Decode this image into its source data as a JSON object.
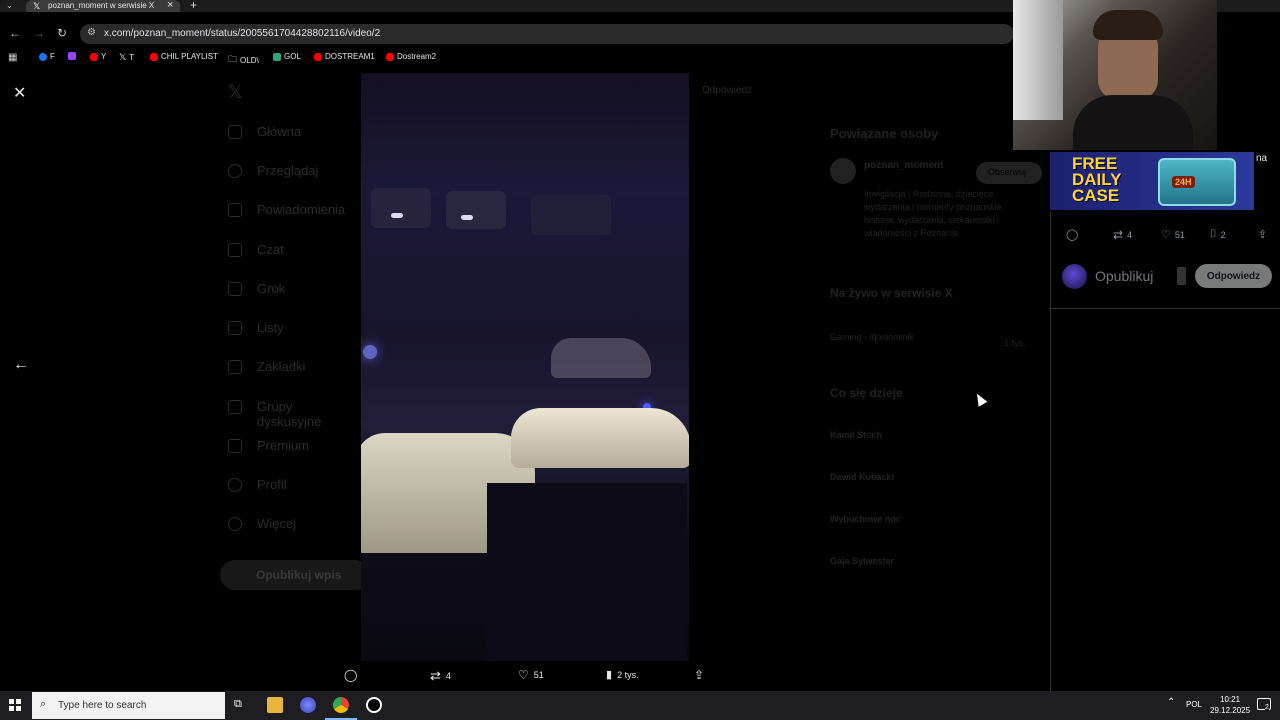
{
  "browser": {
    "tab_title": "poznan_moment w serwisie X",
    "url": "x.com/poznan_moment/status/2005561704428802116/video/2",
    "bookmarks": [
      "F",
      "Y",
      "T",
      "CHIL PLAYLIST",
      "OLD\\",
      "GOL",
      "DOSTREAM1",
      "Dostream2"
    ]
  },
  "x_sidebar": {
    "items": [
      "Główna",
      "Przeglądaj",
      "Powiadomienia",
      "Czat",
      "Grok",
      "Listy",
      "Zakładki",
      "Grupy dyskusyjne",
      "Premium",
      "Profil",
      "Więcej"
    ],
    "post_button": "Opublikuj wpis",
    "reply_tab": "Odpowiedz"
  },
  "x_right": {
    "related_heading": "Powiązane osoby",
    "related_name": "poznan_moment",
    "follow_btn": "Obserwuj",
    "related_bio": "Inwigilacja | Rodzinne, dziecięce wydarzenia i momenty poznańskie, historia, wydarzenia, ciekawostki i wiadomości z Poznania",
    "live_heading": "Na żywo w serwisie X",
    "live_item": "Gaming · @xdominik",
    "live_count": "1 tys.",
    "trends_heading": "Co się dzieje",
    "trends": [
      "Kamil Stoch",
      "Dawid Kubacki",
      "Wybuchowe noc",
      "Gaja Sylwester"
    ]
  },
  "video_controls": {
    "retweets": "4",
    "likes": "51",
    "views": "2 tys."
  },
  "banner": {
    "line1": "FREE",
    "line2": "DAILY",
    "line3": "CASE",
    "chest_label": "24H",
    "overflow_text": "na"
  },
  "right_panel": {
    "retweets": "4",
    "likes": "51",
    "bookmarks": "2",
    "reply_placeholder": "Opublikuj",
    "reply_button": "Odpowiedz"
  },
  "taskbar": {
    "search_placeholder": "Type here to search",
    "language": "POL",
    "time": "10:21",
    "date": "29.12.2025",
    "notifications": "2"
  }
}
